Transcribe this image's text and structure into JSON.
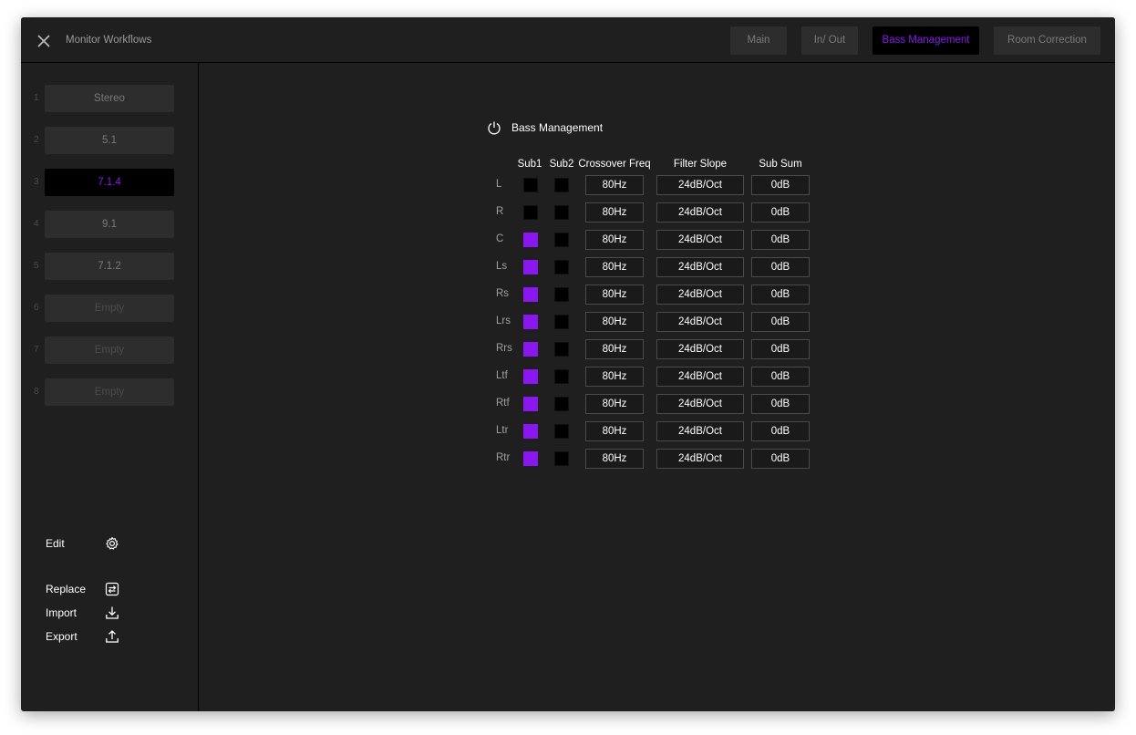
{
  "window": {
    "title": "Monitor Workflows"
  },
  "tabs": [
    {
      "label": "Main",
      "active": false
    },
    {
      "label": "In/ Out",
      "active": false
    },
    {
      "label": "Bass Management",
      "active": true
    },
    {
      "label": "Room Correction",
      "active": false
    }
  ],
  "presets": [
    {
      "num": "1",
      "label": "Stereo",
      "state": "normal"
    },
    {
      "num": "2",
      "label": "5.1",
      "state": "normal"
    },
    {
      "num": "3",
      "label": "7.1.4",
      "state": "active"
    },
    {
      "num": "4",
      "label": "9.1",
      "state": "normal"
    },
    {
      "num": "5",
      "label": "7.1.2",
      "state": "normal"
    },
    {
      "num": "6",
      "label": "Empty",
      "state": "empty"
    },
    {
      "num": "7",
      "label": "Empty",
      "state": "empty"
    },
    {
      "num": "8",
      "label": "Empty",
      "state": "empty"
    }
  ],
  "actions": {
    "edit": {
      "label": "Edit",
      "icon": "gear-icon"
    },
    "replace": {
      "label": "Replace",
      "icon": "replace-icon"
    },
    "import": {
      "label": "Import",
      "icon": "import-icon"
    },
    "export": {
      "label": "Export",
      "icon": "export-icon"
    }
  },
  "bass_management": {
    "title": "Bass Management",
    "power_icon": "power-icon",
    "headers": {
      "sub1": "Sub1",
      "sub2": "Sub2",
      "crossover": "Crossover Freq",
      "slope": "Filter Slope",
      "subsum": "Sub Sum"
    },
    "rows": [
      {
        "ch": "L",
        "sub1": false,
        "sub2": false,
        "crossover": "80Hz",
        "slope": "24dB/Oct",
        "subsum": "0dB"
      },
      {
        "ch": "R",
        "sub1": false,
        "sub2": false,
        "crossover": "80Hz",
        "slope": "24dB/Oct",
        "subsum": "0dB"
      },
      {
        "ch": "C",
        "sub1": true,
        "sub2": false,
        "crossover": "80Hz",
        "slope": "24dB/Oct",
        "subsum": "0dB"
      },
      {
        "ch": "Ls",
        "sub1": true,
        "sub2": false,
        "crossover": "80Hz",
        "slope": "24dB/Oct",
        "subsum": "0dB"
      },
      {
        "ch": "Rs",
        "sub1": true,
        "sub2": false,
        "crossover": "80Hz",
        "slope": "24dB/Oct",
        "subsum": "0dB"
      },
      {
        "ch": "Lrs",
        "sub1": true,
        "sub2": false,
        "crossover": "80Hz",
        "slope": "24dB/Oct",
        "subsum": "0dB"
      },
      {
        "ch": "Rrs",
        "sub1": true,
        "sub2": false,
        "crossover": "80Hz",
        "slope": "24dB/Oct",
        "subsum": "0dB"
      },
      {
        "ch": "Ltf",
        "sub1": true,
        "sub2": false,
        "crossover": "80Hz",
        "slope": "24dB/Oct",
        "subsum": "0dB"
      },
      {
        "ch": "Rtf",
        "sub1": true,
        "sub2": false,
        "crossover": "80Hz",
        "slope": "24dB/Oct",
        "subsum": "0dB"
      },
      {
        "ch": "Ltr",
        "sub1": true,
        "sub2": false,
        "crossover": "80Hz",
        "slope": "24dB/Oct",
        "subsum": "0dB"
      },
      {
        "ch": "Rtr",
        "sub1": true,
        "sub2": false,
        "crossover": "80Hz",
        "slope": "24dB/Oct",
        "subsum": "0dB"
      }
    ]
  },
  "colors": {
    "accent": "#8a18ee",
    "background": "#1f1f1f",
    "button": "#2d2d2d"
  }
}
